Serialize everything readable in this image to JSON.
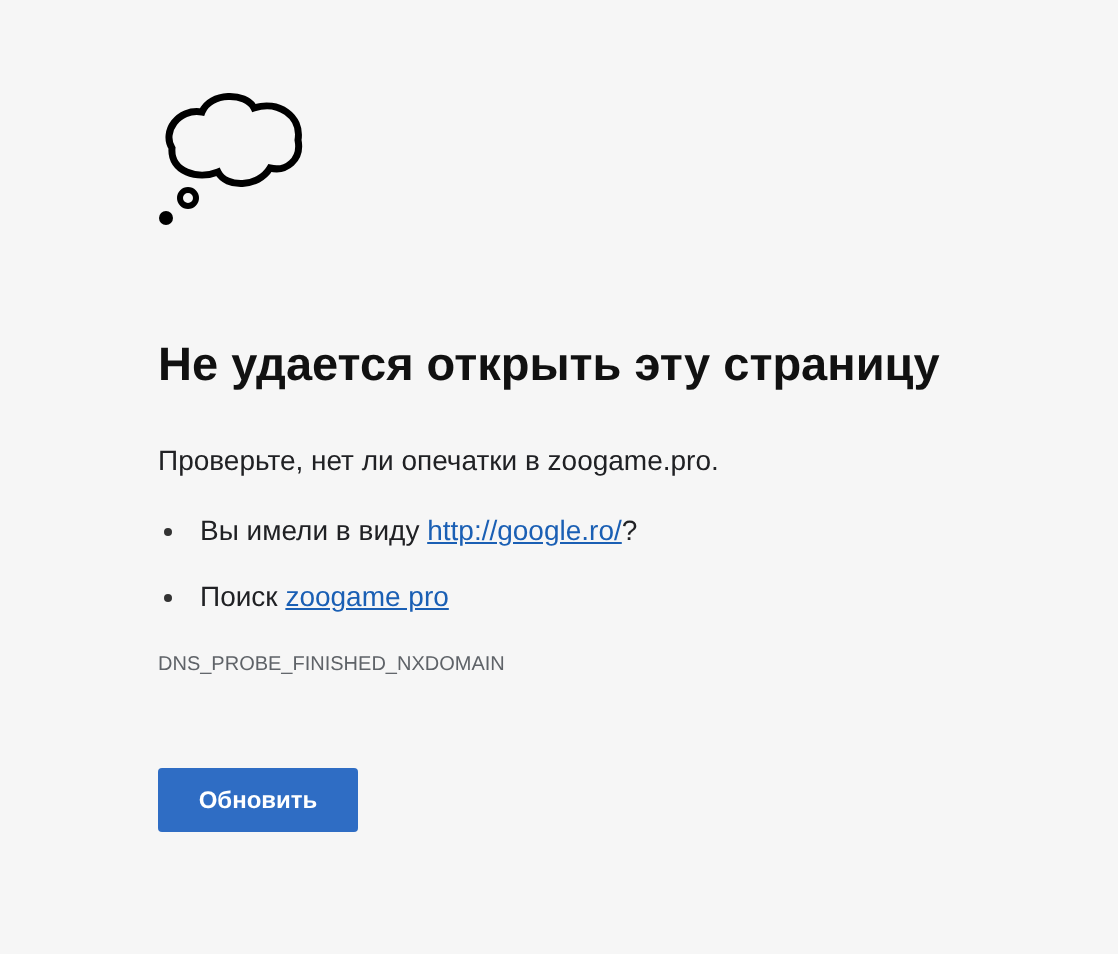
{
  "heading": "Не удается открыть эту страницу",
  "message": "Проверьте, нет ли опечатки в zoogame.pro.",
  "suggestions": [
    {
      "prefix": "Вы имели в виду ",
      "link": "http://google.ro/",
      "suffix": "?"
    },
    {
      "prefix": "Поиск ",
      "link": "zoogame pro"
    }
  ],
  "error_code": "DNS_PROBE_FINISHED_NXDOMAIN",
  "button": "Обновить"
}
